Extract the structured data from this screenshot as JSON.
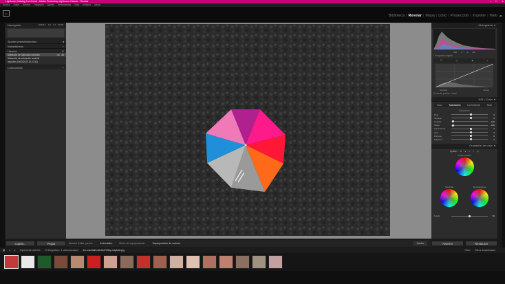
{
  "titlebar": {
    "text": "Lightroom Catalog-2-v11.lrcat - Adobe Photoshop Lightroom Classic - Revelar"
  },
  "menubar": {
    "items": [
      "Archivo",
      "Editar",
      "Revelar",
      "Fotografía",
      "Ajustes",
      "Herramientas",
      "Vista",
      "Ventana",
      "Ayuda"
    ]
  },
  "identity": {
    "logo": "Lr"
  },
  "modules": {
    "items": [
      "Biblioteca",
      "Revelar",
      "Mapa",
      "Libro",
      "Proyección",
      "Imprimir",
      "Web"
    ],
    "active": "Revelar"
  },
  "left_panel": {
    "navigator": {
      "title": "Navegador",
      "zoom_options": [
        "ENCAJ.",
        "1:1",
        "2:1",
        "FILTS."
      ]
    },
    "sections": [
      "Ajustes preestablecidos",
      "Instantáneas",
      "Historia",
      "Colecciones"
    ],
    "history_items": [
      {
        "label": "Alteración de Saturación amarillo",
        "a": "-46",
        "b": "-46"
      },
      {
        "label": "Alteración de saturación amarillo",
        "a": "",
        "b": ""
      },
      {
        "label": "Importar (19/03/2022 10:27:52)",
        "a": "",
        "b": ""
      }
    ],
    "copy_button": "Copiar...",
    "paste_button": "Pegar"
  },
  "toolbar": {
    "items": [
      "Mostrar Editar puntos:",
      "Automático",
      "Modo de superposición:",
      "Superposición de colores"
    ],
    "done_button": "Hecho"
  },
  "right_panel": {
    "histogram_title": "Histograma",
    "histo_values": [
      "ISO",
      "F",
      "1/",
      "EV"
    ],
    "original_label": "Fotografía original",
    "curve_labels": [
      "Oscuras",
      "Claras"
    ],
    "curve_channel": "Curva de puntos: Lineal",
    "hsl_title": "HSL / Color",
    "hsl_tabs": [
      "Tono",
      "Saturación",
      "Luminancia",
      "Todo"
    ],
    "hsl_group": "Saturación",
    "hsl_rows": [
      {
        "label": "Rojo",
        "value": "0",
        "pos": 0.5
      },
      {
        "label": "Naranja",
        "value": "0",
        "pos": 0.5
      },
      {
        "label": "Amarillo",
        "value": "-100",
        "pos": 0.02
      },
      {
        "label": "Verde",
        "value": "-100",
        "pos": 0.02
      },
      {
        "label": "Aguamarina",
        "value": "0",
        "pos": 0.5
      },
      {
        "label": "Azul",
        "value": "0",
        "pos": 0.5
      },
      {
        "label": "Púrpura",
        "value": "0",
        "pos": 0.5
      },
      {
        "label": "Magenta",
        "value": "0",
        "pos": 0.5
      }
    ],
    "color_grading_title": "Gradación de color",
    "cg_adjust_label": "Ajustar:",
    "midtones_label": "Tonos medios",
    "shadows_label": "Sombras",
    "highlights_label": "Iluminaciones",
    "blend_label": "Fusión",
    "blend_value": "50",
    "previous_button": "Anterior",
    "reset_button": "Restaurar"
  },
  "filmstrip_bar": {
    "left_text": "Importación anterior",
    "count_text": "17 fotografías / 1 seleccionadas /",
    "filename": "tim-marshall-cAtzHu0TZ8q-unsplash.jpg",
    "filter_label": "Filtro:",
    "filter_value": "Filtros desactivados"
  },
  "colors": {
    "titlebar": "#c8007a",
    "panel": "#2c2c2c",
    "canvas": "#8c8c8c"
  }
}
